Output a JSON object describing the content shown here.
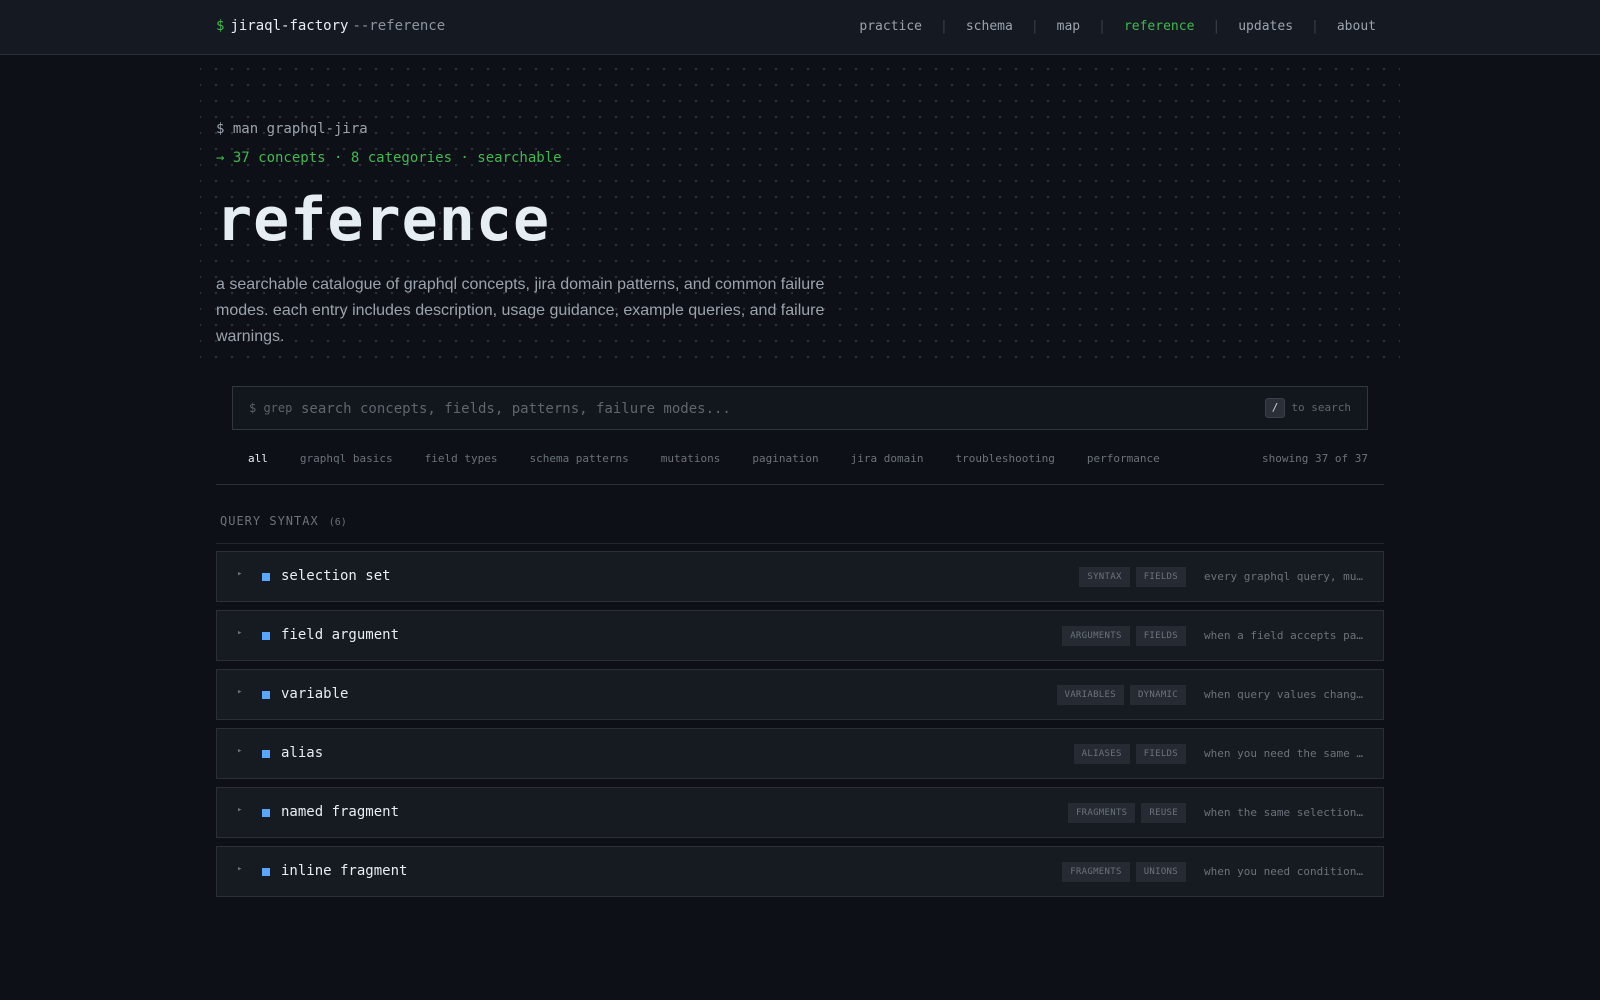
{
  "header": {
    "prompt": "$",
    "brand": "jiraql-factory",
    "brand_suffix": "--reference",
    "nav": [
      {
        "label": "practice",
        "active": false
      },
      {
        "label": "schema",
        "active": false
      },
      {
        "label": "map",
        "active": false
      },
      {
        "label": "reference",
        "active": true
      },
      {
        "label": "updates",
        "active": false
      },
      {
        "label": "about",
        "active": false
      }
    ],
    "separator": "|"
  },
  "hero": {
    "command": "$ man graphql-jira",
    "stats": "→ 37 concepts · 8 categories · searchable",
    "title": "reference",
    "description": "a searchable catalogue of graphql concepts, jira domain patterns, and common failure modes. each entry includes description, usage guidance, example queries, and failure warnings."
  },
  "search": {
    "lead": "$ grep",
    "placeholder": "search concepts, fields, patterns, failure modes...",
    "value": "",
    "shortcut_key": "/",
    "shortcut_hint": "to search"
  },
  "filters": {
    "items": [
      "all",
      "graphql basics",
      "field types",
      "schema patterns",
      "mutations",
      "pagination",
      "jira domain",
      "troubleshooting",
      "performance"
    ],
    "active": "all",
    "count_text": "showing 37 of 37"
  },
  "section": {
    "title": "QUERY SYNTAX",
    "count": "(6)",
    "entries": [
      {
        "name": "selection set",
        "tags": [
          "SYNTAX",
          "FIELDS"
        ],
        "summary": "every graphql query, mu…"
      },
      {
        "name": "field argument",
        "tags": [
          "ARGUMENTS",
          "FIELDS"
        ],
        "summary": "when a field accepts pa…"
      },
      {
        "name": "variable",
        "tags": [
          "VARIABLES",
          "DYNAMIC"
        ],
        "summary": "when query values chang…"
      },
      {
        "name": "alias",
        "tags": [
          "ALIASES",
          "FIELDS"
        ],
        "summary": "when you need the same …"
      },
      {
        "name": "named fragment",
        "tags": [
          "FRAGMENTS",
          "REUSE"
        ],
        "summary": "when the same selection…"
      },
      {
        "name": "inline fragment",
        "tags": [
          "FRAGMENTS",
          "UNIONS"
        ],
        "summary": "when you need condition…"
      }
    ]
  },
  "colors": {
    "background": "#0d1017",
    "accent_green": "#3fb950",
    "accent_blue": "#58a6ff"
  },
  "icons": {
    "row_caret": "caret-right-icon",
    "row_marker": "square-marker-icon"
  }
}
